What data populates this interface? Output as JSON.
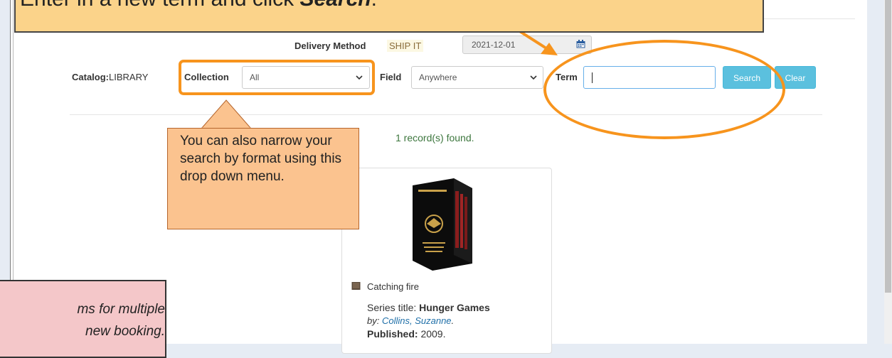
{
  "banner": {
    "prefix": "Enter in a new term and click ",
    "emphasis": "Search",
    "suffix": "."
  },
  "delivery": {
    "label": "Delivery Method",
    "value": "SHIP IT",
    "date": "2021-12-01",
    "date_icon": "calendar-icon"
  },
  "search": {
    "catalog_label": "Catalog:",
    "catalog_value": "LIBRARY",
    "collection_label": "Collection",
    "collection_value": "All",
    "field_label": "Field",
    "field_value": "Anywhere",
    "term_label": "Term",
    "term_value": "",
    "search_button": "Search",
    "clear_button": "Clear"
  },
  "results": {
    "count_text": "1 record(s) found."
  },
  "record": {
    "format_icon": "book-icon",
    "title": "Catching fire",
    "series_label": "Series title:",
    "series_value": "Hunger Games",
    "by_label": "by:",
    "author": "Collins, Suzanne",
    "by_suffix": ".",
    "published_label": "Published:",
    "published_value": "2009."
  },
  "callouts": {
    "collection_tip": "You can also narrow your search by format using this drop down menu.",
    "pink_line1": "ms for multiple",
    "pink_line2": "new booking."
  },
  "colors": {
    "highlight_orange": "#f7941d",
    "button_blue": "#5bc0de",
    "found_green": "#3c763d",
    "author_link": "#1f6fa8"
  }
}
